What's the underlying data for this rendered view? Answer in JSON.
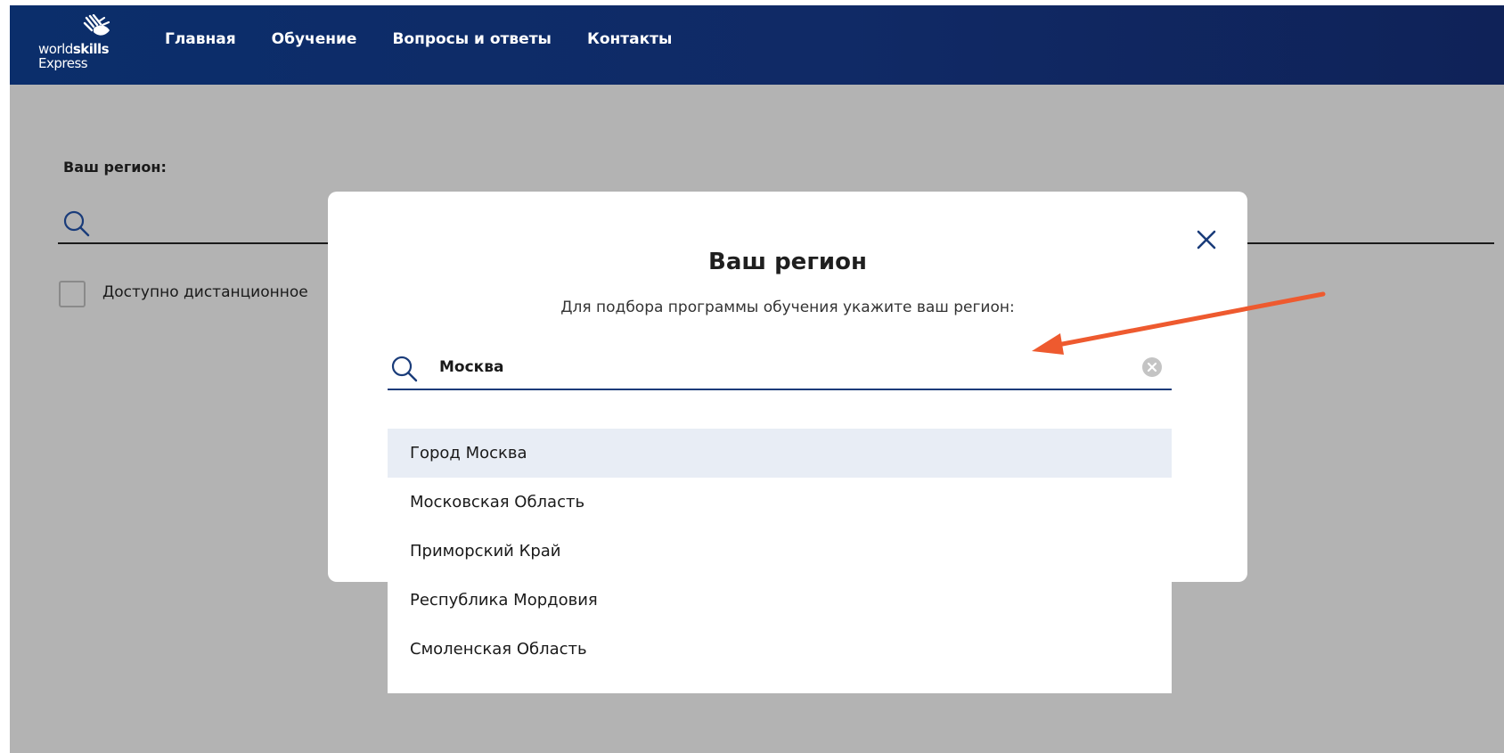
{
  "header": {
    "logo": {
      "word_light": "world",
      "word_bold": "skills",
      "sub": "Express"
    },
    "nav": [
      {
        "label": "Главная"
      },
      {
        "label": "Обучение"
      },
      {
        "label": "Вопросы и ответы"
      },
      {
        "label": "Контакты"
      }
    ]
  },
  "background": {
    "region_label": "Ваш регион:",
    "remote_checkbox_label": "Доступно дистанционное"
  },
  "modal": {
    "title": "Ваш регион",
    "subtitle": "Для подбора программы обучения укажите ваш регион:",
    "search": {
      "value": "Москва",
      "placeholder": ""
    },
    "results": [
      {
        "label": "Город Москва",
        "active": true
      },
      {
        "label": "Московская Область",
        "active": false
      },
      {
        "label": "Приморский Край",
        "active": false
      },
      {
        "label": "Республика Мордовия",
        "active": false
      },
      {
        "label": "Смоленская Область",
        "active": false
      }
    ]
  },
  "colors": {
    "header_bg": "#0b2e6b",
    "accent": "#1a3c7a",
    "overlay": "#b3b3b3",
    "active_row": "#e8edf5",
    "annotation_arrow": "#ee5a2f"
  },
  "icons": {
    "search": "search-icon",
    "close": "close-icon",
    "clear": "clear-circle-icon",
    "logo_mark": "skills-hands-icon"
  }
}
